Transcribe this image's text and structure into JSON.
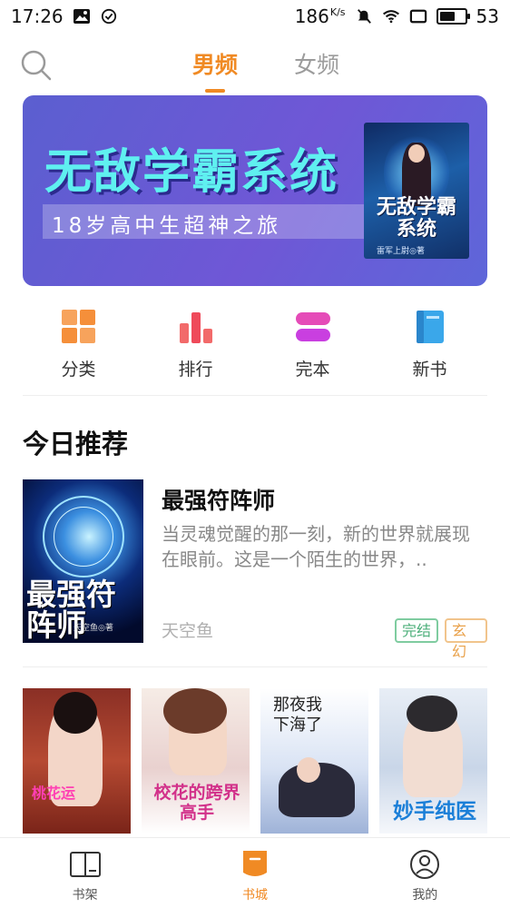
{
  "status_bar": {
    "time": "17:26",
    "net_speed": "186",
    "net_speed_unit": "K/s",
    "battery": "53"
  },
  "top_nav": {
    "tabs": [
      {
        "label": "男频",
        "active": true
      },
      {
        "label": "女频",
        "active": false
      }
    ]
  },
  "banner": {
    "title": "无敌学霸系统",
    "subtitle": "18岁高中生超神之旅",
    "cover_title": "无敌学霸系统",
    "cover_author": "雷军上尉◎著"
  },
  "categories": [
    {
      "label": "分类",
      "icon": "grid-icon"
    },
    {
      "label": "排行",
      "icon": "ranking-icon"
    },
    {
      "label": "完本",
      "icon": "finished-icon"
    },
    {
      "label": "新书",
      "icon": "new-book-icon"
    }
  ],
  "today_section": {
    "title": "今日推荐",
    "featured": {
      "cover_title": "最强符阵师",
      "cover_author": "天空鱼◎著",
      "title": "最强符阵师",
      "description": "当灵魂觉醒的那一刻，新的世界就展现在眼前。这是一个陌生的世界，..",
      "author": "天空鱼",
      "status_tag": "完结",
      "genre_tag": "玄幻"
    }
  },
  "cover_grid": [
    {
      "cover_text": "桃花运"
    },
    {
      "cover_text": "校花的跨界高手"
    },
    {
      "cover_text": "那夜我下海了"
    },
    {
      "cover_text": "妙手纯医"
    }
  ],
  "bottom_nav": [
    {
      "label": "书架",
      "icon": "bookshelf-icon",
      "active": false
    },
    {
      "label": "书城",
      "icon": "bookstore-icon",
      "active": true
    },
    {
      "label": "我的",
      "icon": "profile-icon",
      "active": false
    }
  ],
  "colors": {
    "accent": "#f08a24",
    "banner": "#6a5bd6",
    "tag_green": "#4caf7a",
    "tag_orange": "#e9a14a"
  }
}
